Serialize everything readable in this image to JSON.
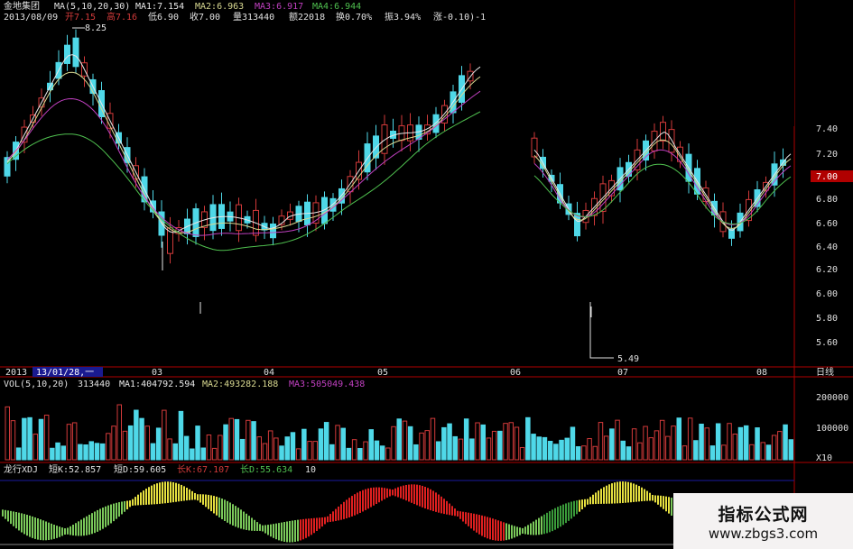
{
  "colors": {
    "up": "#d23a3a",
    "down": "#4fd8e8",
    "ma1": "#e8e8e8",
    "ma2": "#d8d890",
    "ma3": "#c040c0",
    "ma4": "#4fc04f",
    "axis": "#b00000",
    "text": "#e0e0e0"
  },
  "header": {
    "stock": "金地集团",
    "ma_params": "MA(5,10,20,30)",
    "ma1": "MA1:7.154",
    "ma2": "MA2:6.963",
    "ma3": "MA3:6.917",
    "ma4": "MA4:6.944",
    "date": "2013/08/09",
    "open": "开7.15",
    "high": "高7.16",
    "low": "低6.90",
    "close": "收7.00",
    "volume": "量313440",
    "amount": "额22018",
    "turnover": "换0.70%",
    "amplitude": "振3.94%",
    "change": "涨-0.10)-1"
  },
  "price_axis": [
    "7.40",
    "7.20",
    "7.00",
    "6.80",
    "6.60",
    "6.40",
    "6.20",
    "6.00",
    "5.80",
    "5.60"
  ],
  "current_price": "7.00",
  "annotations": {
    "high": "8.25",
    "low": "5.49"
  },
  "time_axis": {
    "year": "2013",
    "cursor": "13/01/28,一",
    "months": [
      "03",
      "04",
      "05",
      "06",
      "07",
      "08"
    ],
    "period": "日线"
  },
  "vol_header": {
    "params": "VOL(5,10,20)",
    "value": "313440",
    "ma1": "MA1:404792.594",
    "ma2": "MA2:493282.188",
    "ma3": "MA3:505049.438"
  },
  "vol_axis": [
    "200000",
    "100000"
  ],
  "vol_unit": "X10",
  "ind_header": {
    "name": "龙行XDJ",
    "k": "短K:52.857",
    "d": "短D:59.605",
    "k2": "长K:67.107",
    "d2": "长D:55.634",
    "val": "10"
  },
  "watermark": {
    "cn": "指标公式网",
    "url": "www.zbgs3.com"
  }
}
